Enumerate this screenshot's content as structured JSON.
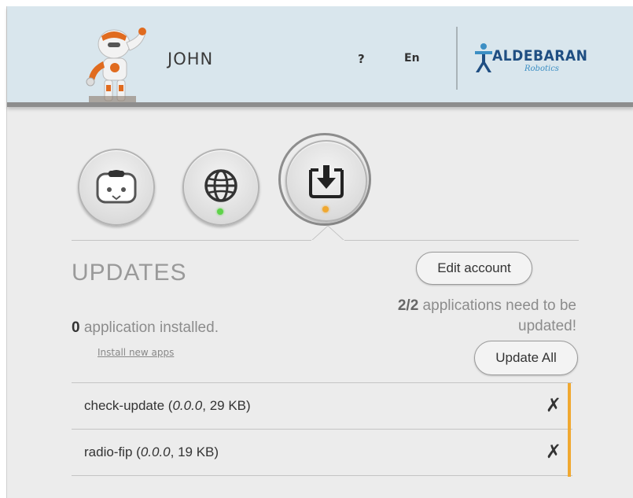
{
  "header": {
    "username": "JOHN",
    "help": "?",
    "language": "En",
    "logo_text": "ALDEBARAN",
    "logo_sub": "Robotics"
  },
  "nav": {
    "items": [
      {
        "icon": "robot-head-icon",
        "status": "none"
      },
      {
        "icon": "globe-icon",
        "status": "ok"
      },
      {
        "icon": "download-icon",
        "status": "pending",
        "active": true
      }
    ]
  },
  "section": {
    "title": "UPDATES",
    "edit_account_label": "Edit account",
    "installed_count": "0",
    "installed_text": " application installed.",
    "install_new_label": "Install new apps",
    "need_update_count": "2/2",
    "need_update_text_1": " applications need to be",
    "need_update_text_2": "updated!",
    "update_all_label": "Update All"
  },
  "updates": [
    {
      "name": "check-update (",
      "version": "0.0.0",
      "size": ", 29 KB)",
      "delete": "✗"
    },
    {
      "name": "radio-fip (",
      "version": "0.0.0",
      "size": ", 19 KB)",
      "delete": "✗"
    }
  ],
  "colors": {
    "header_bg": "#d9e6ed",
    "accent_orange": "#f0a830",
    "status_green": "#5fd34a",
    "status_orange": "#f0a830",
    "logo_blue": "#1f4e82"
  }
}
